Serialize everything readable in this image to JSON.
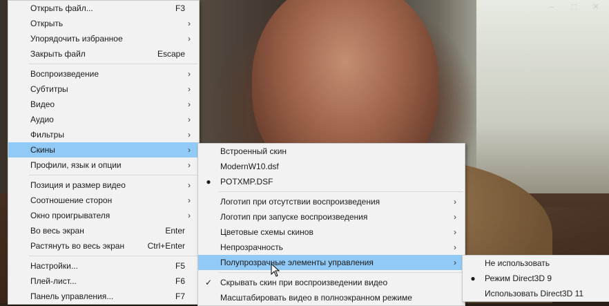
{
  "window_controls": [
    "–",
    "□",
    "✕"
  ],
  "main_menu": {
    "items": [
      {
        "label": "Открыть файл...",
        "shortcut": "F3",
        "submenu": false
      },
      {
        "label": "Открыть",
        "shortcut": "",
        "submenu": true
      },
      {
        "label": "Упорядочить избранное",
        "shortcut": "",
        "submenu": true
      },
      {
        "label": "Закрыть файл",
        "shortcut": "Escape",
        "submenu": false
      },
      {
        "sep": true
      },
      {
        "label": "Воспроизведение",
        "shortcut": "",
        "submenu": true
      },
      {
        "label": "Субтитры",
        "shortcut": "",
        "submenu": true
      },
      {
        "label": "Видео",
        "shortcut": "",
        "submenu": true
      },
      {
        "label": "Аудио",
        "shortcut": "",
        "submenu": true
      },
      {
        "label": "Фильтры",
        "shortcut": "",
        "submenu": true
      },
      {
        "label": "Скины",
        "shortcut": "",
        "submenu": true,
        "highlighted": true
      },
      {
        "label": "Профили, язык и опции",
        "shortcut": "",
        "submenu": true
      },
      {
        "sep": true
      },
      {
        "label": "Позиция и размер видео",
        "shortcut": "",
        "submenu": true
      },
      {
        "label": "Соотношение сторон",
        "shortcut": "",
        "submenu": true
      },
      {
        "label": "Окно проигрывателя",
        "shortcut": "",
        "submenu": true
      },
      {
        "label": "Во весь экран",
        "shortcut": "Enter",
        "submenu": false
      },
      {
        "label": "Растянуть во весь экран",
        "shortcut": "Ctrl+Enter",
        "submenu": false
      },
      {
        "sep": true
      },
      {
        "label": "Настройки...",
        "shortcut": "F5",
        "submenu": false
      },
      {
        "label": "Плей-лист...",
        "shortcut": "F6",
        "submenu": false
      },
      {
        "label": "Панель управления...",
        "shortcut": "F7",
        "submenu": false
      }
    ]
  },
  "skins_menu": {
    "items": [
      {
        "label": "Встроенный скин",
        "mark": ""
      },
      {
        "label": "ModernW10.dsf",
        "mark": ""
      },
      {
        "label": "POTXMP.DSF",
        "mark": "●"
      },
      {
        "sep": true
      },
      {
        "label": "Логотип при отсутствии воспроизведения",
        "submenu": true
      },
      {
        "label": "Логотип при запуске воспроизведения",
        "submenu": true
      },
      {
        "label": "Цветовые схемы скинов",
        "submenu": true
      },
      {
        "label": "Непрозрачность",
        "submenu": true
      },
      {
        "label": "Полупрозрачные элементы управления",
        "submenu": true,
        "highlighted": true
      },
      {
        "sep": true
      },
      {
        "label": "Скрывать скин при воспроизведении видео",
        "mark": "✓"
      },
      {
        "label": "Масштабировать видео в полноэкранном режиме",
        "mark": ""
      }
    ]
  },
  "transparency_menu": {
    "items": [
      {
        "label": "Не использовать",
        "mark": ""
      },
      {
        "label": "Режим Direct3D 9",
        "mark": "●"
      },
      {
        "label": "Использовать Direct3D 11",
        "mark": ""
      }
    ]
  },
  "colors": {
    "highlight": "#91c9f7",
    "menu_bg": "#f2f2f2"
  }
}
